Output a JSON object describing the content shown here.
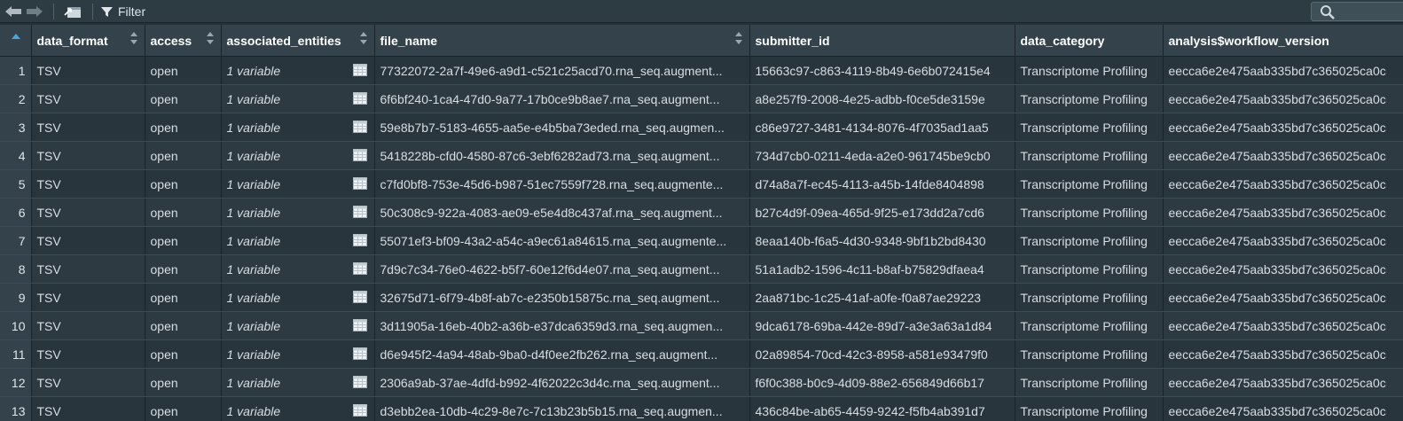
{
  "toolbar": {
    "back_icon": "back-arrow-icon",
    "forward_icon": "forward-arrow-icon",
    "popout_icon": "popout-window-icon",
    "filter_label": "Filter",
    "search_icon": "search-icon",
    "search_placeholder": ""
  },
  "table": {
    "columns": [
      {
        "label": ""
      },
      {
        "label": "data_format"
      },
      {
        "label": "access"
      },
      {
        "label": "associated_entities"
      },
      {
        "label": "file_name"
      },
      {
        "label": "submitter_id"
      },
      {
        "label": "data_category"
      },
      {
        "label": "analysis$workflow_version"
      }
    ],
    "rows": [
      {
        "n": "1",
        "data_format": "TSV",
        "access": "open",
        "associated_entities": "1 variable",
        "file_name": "77322072-2a7f-49e6-a9d1-c521c25acd70.rna_seq.augment...",
        "submitter_id": "15663c97-c863-4119-8b49-6e6b072415e4",
        "data_category": "Transcriptome Profiling",
        "workflow_version": "eecca6e2e475aab335bd7c365025ca0c"
      },
      {
        "n": "2",
        "data_format": "TSV",
        "access": "open",
        "associated_entities": "1 variable",
        "file_name": "6f6bf240-1ca4-47d0-9a77-17b0ce9b8ae7.rna_seq.augment...",
        "submitter_id": "a8e257f9-2008-4e25-adbb-f0ce5de3159e",
        "data_category": "Transcriptome Profiling",
        "workflow_version": "eecca6e2e475aab335bd7c365025ca0c"
      },
      {
        "n": "3",
        "data_format": "TSV",
        "access": "open",
        "associated_entities": "1 variable",
        "file_name": "59e8b7b7-5183-4655-aa5e-e4b5ba73eded.rna_seq.augmen...",
        "submitter_id": "c86e9727-3481-4134-8076-4f7035ad1aa5",
        "data_category": "Transcriptome Profiling",
        "workflow_version": "eecca6e2e475aab335bd7c365025ca0c"
      },
      {
        "n": "4",
        "data_format": "TSV",
        "access": "open",
        "associated_entities": "1 variable",
        "file_name": "5418228b-cfd0-4580-87c6-3ebf6282ad73.rna_seq.augment...",
        "submitter_id": "734d7cb0-0211-4eda-a2e0-961745be9cb0",
        "data_category": "Transcriptome Profiling",
        "workflow_version": "eecca6e2e475aab335bd7c365025ca0c"
      },
      {
        "n": "5",
        "data_format": "TSV",
        "access": "open",
        "associated_entities": "1 variable",
        "file_name": "c7fd0bf8-753e-45d6-b987-51ec7559f728.rna_seq.augmente...",
        "submitter_id": "d74a8a7f-ec45-4113-a45b-14fde8404898",
        "data_category": "Transcriptome Profiling",
        "workflow_version": "eecca6e2e475aab335bd7c365025ca0c"
      },
      {
        "n": "6",
        "data_format": "TSV",
        "access": "open",
        "associated_entities": "1 variable",
        "file_name": "50c308c9-922a-4083-ae09-e5e4d8c437af.rna_seq.augment...",
        "submitter_id": "b27c4d9f-09ea-465d-9f25-e173dd2a7cd6",
        "data_category": "Transcriptome Profiling",
        "workflow_version": "eecca6e2e475aab335bd7c365025ca0c"
      },
      {
        "n": "7",
        "data_format": "TSV",
        "access": "open",
        "associated_entities": "1 variable",
        "file_name": "55071ef3-bf09-43a2-a54c-a9ec61a84615.rna_seq.augmente...",
        "submitter_id": "8eaa140b-f6a5-4d30-9348-9bf1b2bd8430",
        "data_category": "Transcriptome Profiling",
        "workflow_version": "eecca6e2e475aab335bd7c365025ca0c"
      },
      {
        "n": "8",
        "data_format": "TSV",
        "access": "open",
        "associated_entities": "1 variable",
        "file_name": "7d9c7c34-76e0-4622-b5f7-60e12f6d4e07.rna_seq.augment...",
        "submitter_id": "51a1adb2-1596-4c11-b8af-b75829dfaea4",
        "data_category": "Transcriptome Profiling",
        "workflow_version": "eecca6e2e475aab335bd7c365025ca0c"
      },
      {
        "n": "9",
        "data_format": "TSV",
        "access": "open",
        "associated_entities": "1 variable",
        "file_name": "32675d71-6f79-4b8f-ab7c-e2350b15875c.rna_seq.augment...",
        "submitter_id": "2aa871bc-1c25-41af-a0fe-f0a87ae29223",
        "data_category": "Transcriptome Profiling",
        "workflow_version": "eecca6e2e475aab335bd7c365025ca0c"
      },
      {
        "n": "10",
        "data_format": "TSV",
        "access": "open",
        "associated_entities": "1 variable",
        "file_name": "3d11905a-16eb-40b2-a36b-e37dca6359d3.rna_seq.augmen...",
        "submitter_id": "9dca6178-69ba-442e-89d7-a3e3a63a1d84",
        "data_category": "Transcriptome Profiling",
        "workflow_version": "eecca6e2e475aab335bd7c365025ca0c"
      },
      {
        "n": "11",
        "data_format": "TSV",
        "access": "open",
        "associated_entities": "1 variable",
        "file_name": "d6e945f2-4a94-48ab-9ba0-d4f0ee2fb262.rna_seq.augment...",
        "submitter_id": "02a89854-70cd-42c3-8958-a581e93479f0",
        "data_category": "Transcriptome Profiling",
        "workflow_version": "eecca6e2e475aab335bd7c365025ca0c"
      },
      {
        "n": "12",
        "data_format": "TSV",
        "access": "open",
        "associated_entities": "1 variable",
        "file_name": "2306a9ab-37ae-4dfd-b992-4f62022c3d4c.rna_seq.augment...",
        "submitter_id": "f6f0c388-b0c9-4d09-88e2-656849d66b17",
        "data_category": "Transcriptome Profiling",
        "workflow_version": "eecca6e2e475aab335bd7c365025ca0c"
      },
      {
        "n": "13",
        "data_format": "TSV",
        "access": "open",
        "associated_entities": "1 variable",
        "file_name": "d3ebb2ea-10db-4c29-8e7c-7c13b23b5b15.rna_seq.augmen...",
        "submitter_id": "436c84be-ab65-4459-9242-f5fb4ab391d7",
        "data_category": "Transcriptome Profiling",
        "workflow_version": "eecca6e2e475aab335bd7c365025ca0c"
      }
    ]
  }
}
